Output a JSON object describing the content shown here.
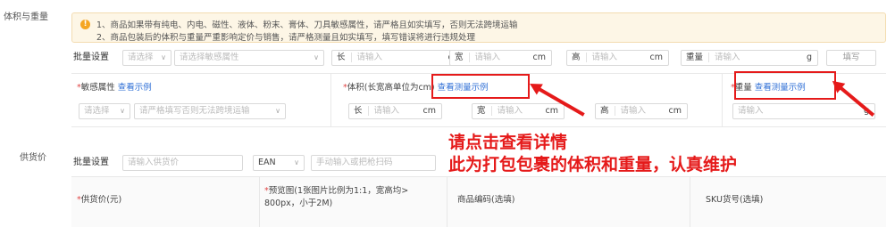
{
  "section_labels": {
    "dimensions": "体积与重量",
    "supply_price": "供货价"
  },
  "warning": {
    "line1": "1、商品如果带有纯电、内电、磁性、液体、粉末、膏体、刀具敏感属性，请严格且如实填写，否则无法跨境运输",
    "line2": "2、商品包装后的体积与重量严重影响定价与销售，请严格测量且如实填写，填写错误将进行违规处理"
  },
  "batch_row": {
    "label": "批量设置",
    "select1_placeholder": "请选择",
    "select2_placeholder": "请选择敏感属性",
    "length_label": "长",
    "width_label": "宽",
    "height_label": "高",
    "weight_label": "重量",
    "input_placeholder": "请输入",
    "cm": "cm",
    "g": "g",
    "fill_button": "填写"
  },
  "table_headers": {
    "sensitive": {
      "asterisk": "*",
      "label": "敏感属性",
      "link": "查看示例"
    },
    "volume": {
      "asterisk": "*",
      "label": "体积(长宽高单位为cm)",
      "link": "查看测量示例"
    },
    "weight": {
      "asterisk": "*",
      "label": "重量",
      "link": "查看测量示例"
    }
  },
  "row_inputs": {
    "select1_placeholder": "请选择",
    "select2_placeholder": "请严格填写否则无法跨境运输",
    "length_label": "长",
    "width_label": "宽",
    "height_label": "高",
    "input_placeholder": "请输入",
    "cm": "cm",
    "g": "g"
  },
  "annotation": {
    "line1": "请点击查看详情",
    "line2": "此为打包包裹的体积和重量，认真维护",
    "color": "#e51a1a"
  },
  "supply_batch": {
    "label": "批量设置",
    "price_placeholder": "请输入供货价",
    "code_type": "EAN",
    "code_placeholder": "手动输入或把枪扫码"
  },
  "supply_table": {
    "headers": {
      "price": {
        "asterisk": "*",
        "label": "供货价(元)"
      },
      "preview": {
        "asterisk": "*",
        "label_line1": "预览图(1张图片比例为1:1，宽高均>",
        "label_line2": "800px，小于2M)"
      },
      "product_code": "商品编码(选填)",
      "sku": "SKU货号(选填)"
    }
  }
}
